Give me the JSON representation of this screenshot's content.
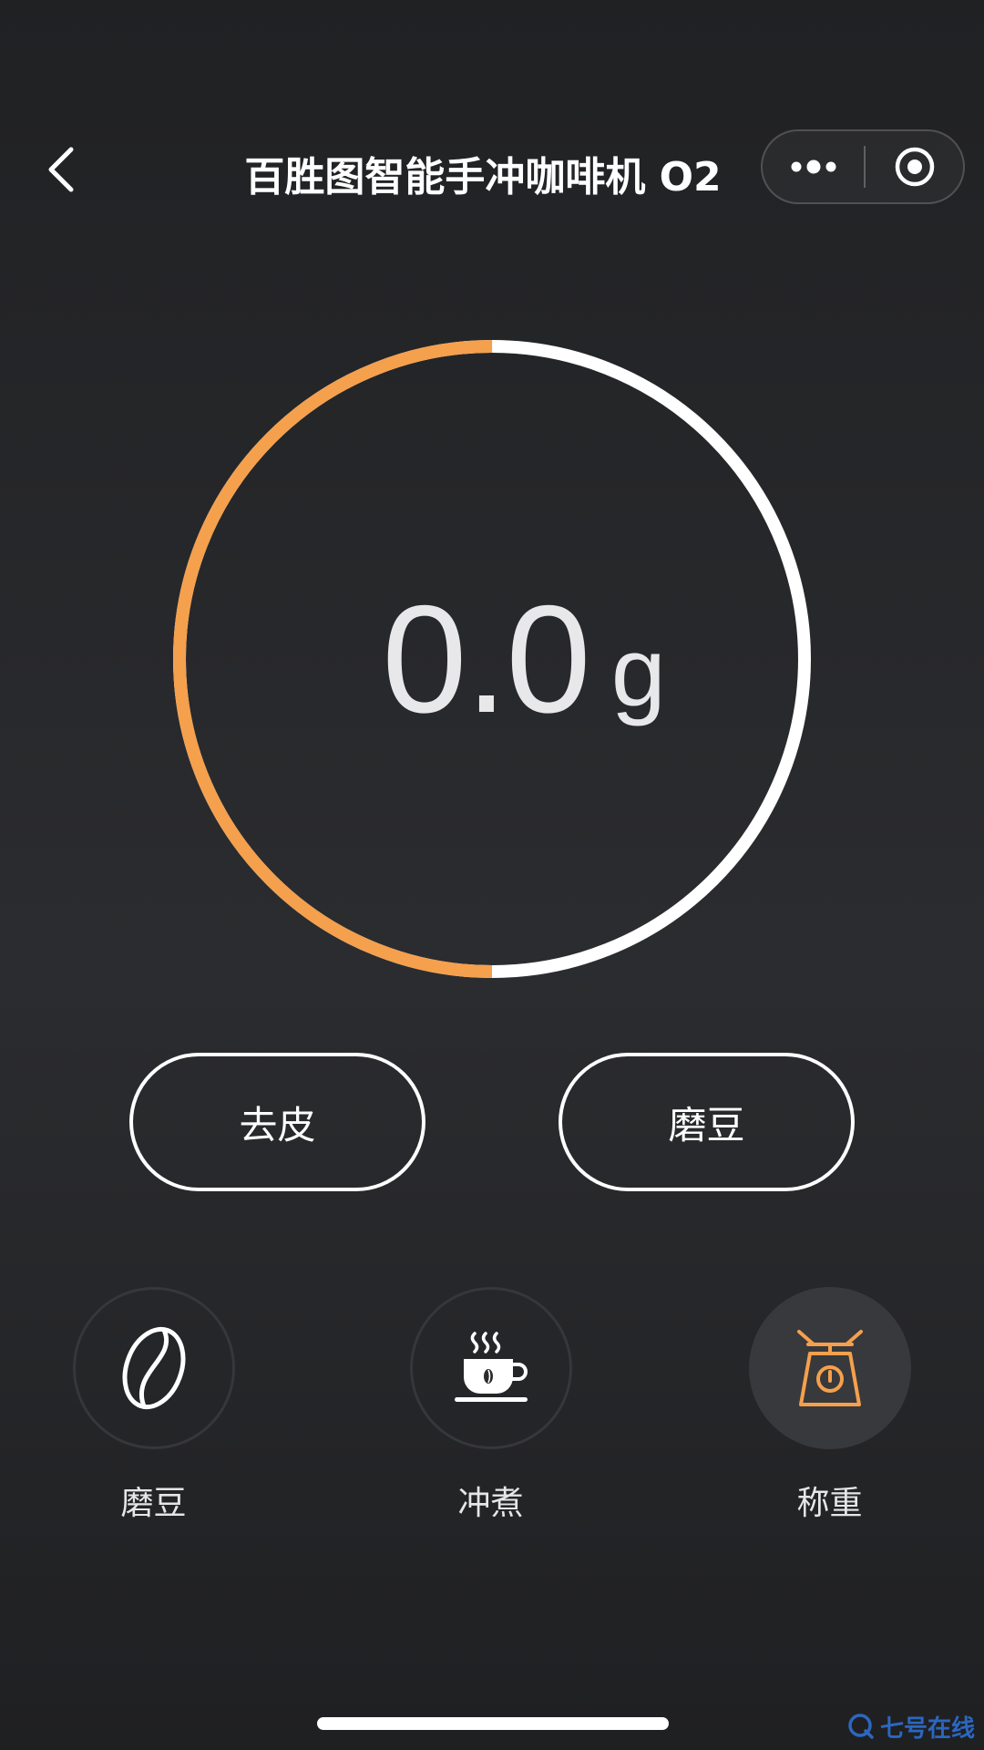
{
  "header": {
    "title": "百胜图智能手冲咖啡机 O2",
    "back_icon": "chevron-left-icon",
    "more_icon": "more-dots-icon",
    "close_icon": "target-circle-icon"
  },
  "scale": {
    "value": "0.0",
    "unit": "g",
    "ring_progress_fraction": 0.5,
    "ring_progress_color": "#f4a04d",
    "ring_track_color": "#ffffff"
  },
  "actions": {
    "tare_label": "去皮",
    "grind_label": "磨豆"
  },
  "modes": [
    {
      "label": "磨豆",
      "icon": "coffee-bean-icon",
      "active": false
    },
    {
      "label": "冲煮",
      "icon": "coffee-cup-icon",
      "active": false
    },
    {
      "label": "称重",
      "icon": "scale-icon",
      "active": true
    }
  ],
  "colors": {
    "accent": "#f4a04d",
    "text": "#ffffff",
    "background": "#232426"
  },
  "watermark": {
    "text": "七号在线"
  }
}
